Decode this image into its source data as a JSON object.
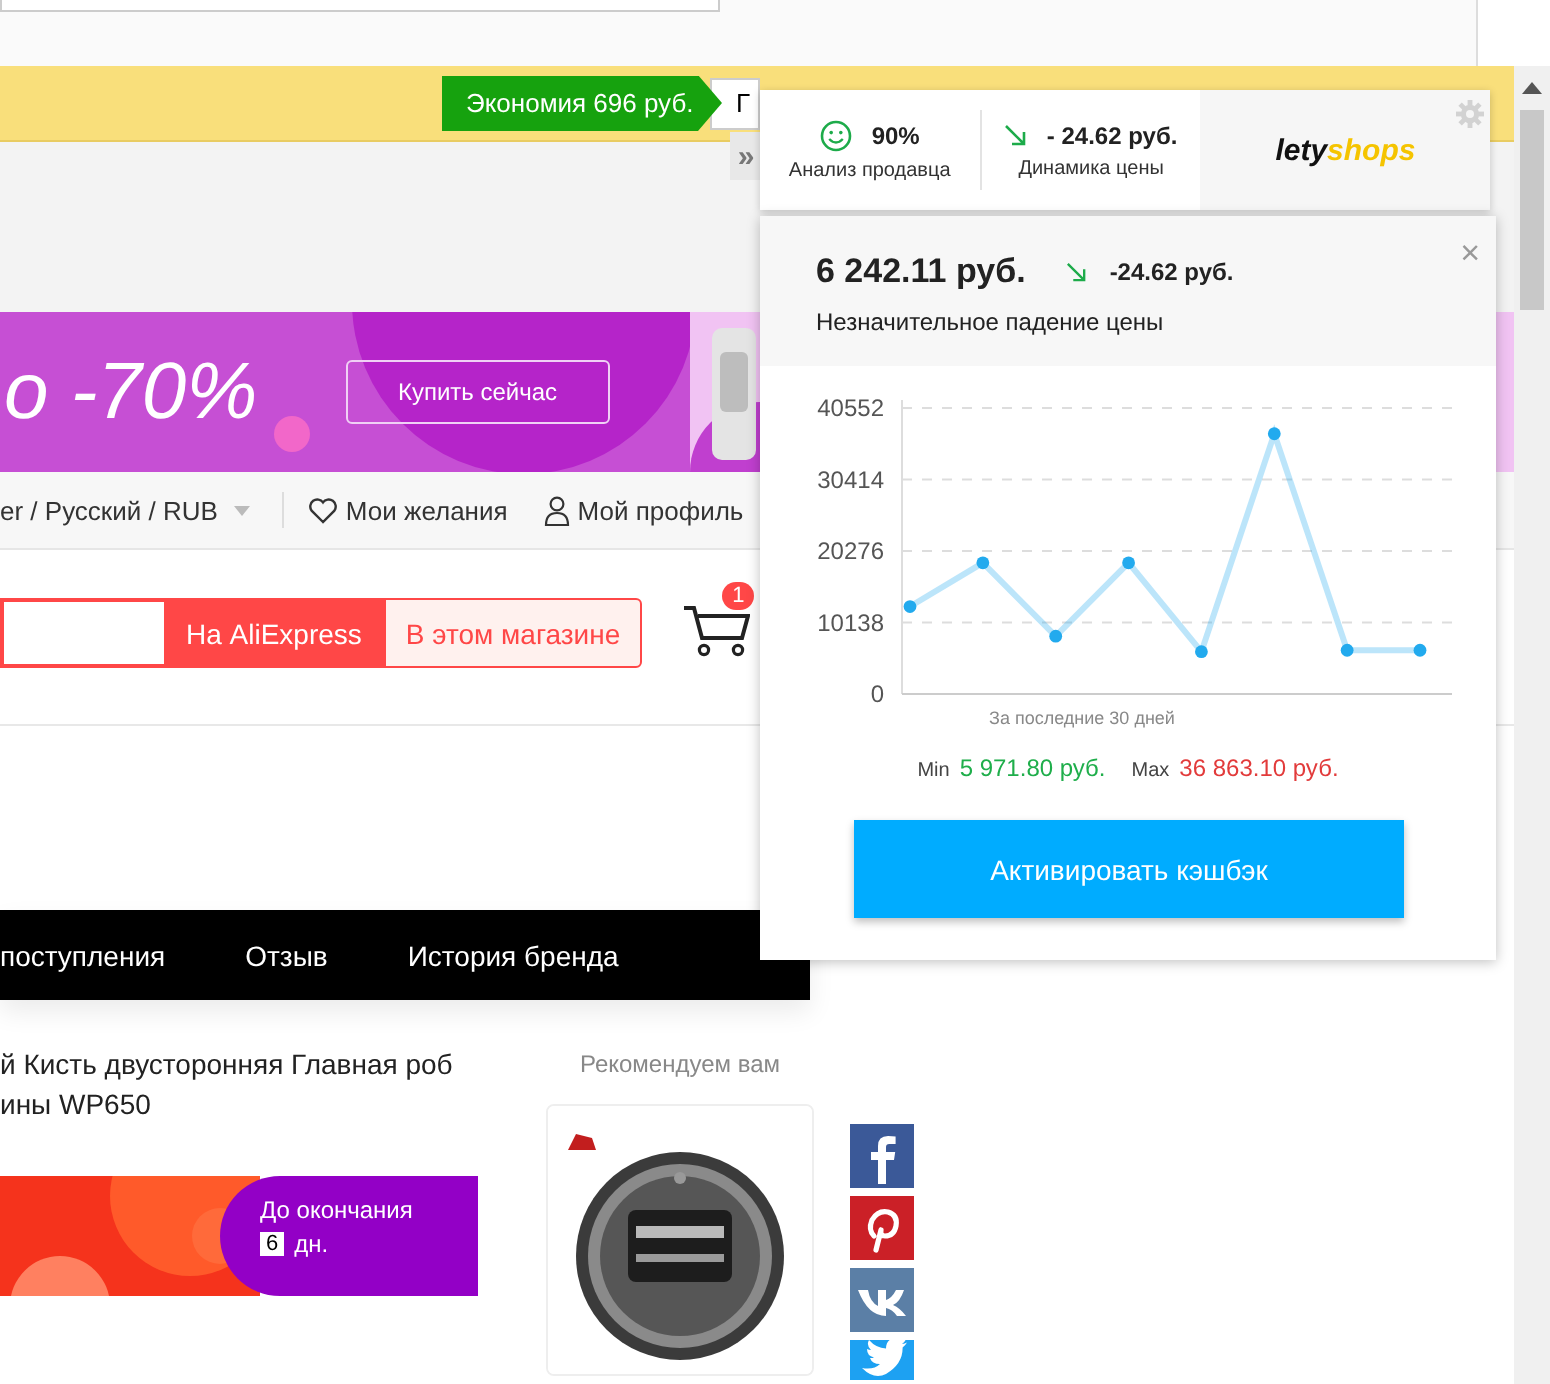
{
  "savings_bar": {
    "savings_tag": "Экономия 696 руб.",
    "cut_box_text": "Г"
  },
  "banner": {
    "headline": "о -70%",
    "button": "Купить сейчас"
  },
  "top_nav": {
    "locale": "er / Русский /  RUB",
    "wishlist": "Мои желания",
    "profile": "Мой профиль"
  },
  "search": {
    "buttons": [
      {
        "label": "На AliExpress",
        "selected": true
      },
      {
        "label": "В этом магазине",
        "selected": false
      }
    ],
    "cart_badge": "1"
  },
  "store_nav": {
    "items": [
      "поступления",
      "Отзыв",
      "История бренда"
    ]
  },
  "product": {
    "title_lines": [
      "й Кисть двусторонняя Главная роб",
      "ины WP650"
    ],
    "promo": {
      "label": "До окончания",
      "days": "6",
      "unit": "дн."
    }
  },
  "recommend": {
    "heading": "Рекомендуем вам"
  },
  "share": [
    {
      "kind": "facebook"
    },
    {
      "kind": "pinterest"
    },
    {
      "kind": "vk"
    },
    {
      "kind": "twitter"
    }
  ],
  "letyshops": {
    "expand_glyph": "»",
    "stats": [
      {
        "kind": "seller",
        "value": "90%",
        "label": "Анализ продавца"
      },
      {
        "kind": "trend",
        "value": "- 24.62 руб.",
        "label": "Динамика цены"
      }
    ],
    "logo": [
      "lety",
      "shops"
    ],
    "price": "6 242.11 руб.",
    "change": "-24.62 руб.",
    "verdict": "Незначительное падение цены",
    "close_glyph": "×",
    "chart_data": {
      "type": "line",
      "xlabel": "За последние 30 дней",
      "ylim": [
        0,
        40552
      ],
      "yticks": [
        0,
        10138,
        20276,
        30414,
        40552
      ],
      "categories": [
        null,
        null,
        null,
        null,
        null,
        null,
        null,
        null
      ],
      "grid": true,
      "series": [
        {
          "color": "#22aaee",
          "marker": true,
          "values": [
            12400,
            18600,
            8200,
            18600,
            6000,
            36900,
            6200,
            6200
          ]
        }
      ]
    },
    "min_label": "Min",
    "min": "5 971.80 руб.",
    "max_label": "Max",
    "max": "36 863.10 руб.",
    "cta": "Активировать кэшбэк"
  }
}
